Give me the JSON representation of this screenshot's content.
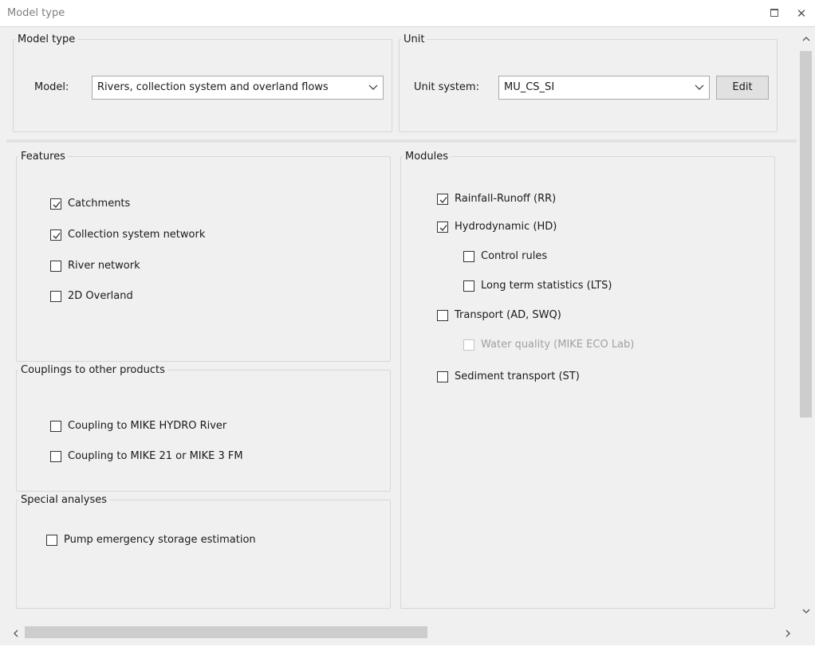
{
  "window": {
    "title": "Model type"
  },
  "model_type": {
    "legend": "Model type",
    "model_label": "Model:",
    "model_value": "Rivers, collection system and overland flows"
  },
  "unit": {
    "legend": "Unit",
    "unit_system_label": "Unit system:",
    "unit_system_value": "MU_CS_SI",
    "edit_label": "Edit"
  },
  "features": {
    "legend": "Features",
    "items": [
      {
        "label": "Catchments",
        "checked": true
      },
      {
        "label": "Collection system network",
        "checked": true
      },
      {
        "label": "River network",
        "checked": false
      },
      {
        "label": "2D Overland",
        "checked": false
      }
    ]
  },
  "couplings": {
    "legend": "Couplings to other products",
    "items": [
      {
        "label": "Coupling to MIKE HYDRO River",
        "checked": false
      },
      {
        "label": "Coupling to MIKE 21 or MIKE 3 FM",
        "checked": false
      }
    ]
  },
  "special": {
    "legend": "Special analyses",
    "items": [
      {
        "label": "Pump emergency storage estimation",
        "checked": false
      }
    ]
  },
  "modules": {
    "legend": "Modules",
    "items": [
      {
        "label": "Rainfall-Runoff (RR)",
        "checked": true,
        "enabled": true
      },
      {
        "label": "Hydrodynamic (HD)",
        "checked": true,
        "enabled": true
      },
      {
        "label": "Control rules",
        "checked": false,
        "enabled": true
      },
      {
        "label": "Long term statistics (LTS)",
        "checked": false,
        "enabled": true
      },
      {
        "label": "Transport (AD, SWQ)",
        "checked": false,
        "enabled": true
      },
      {
        "label": "Water quality (MIKE ECO Lab)",
        "checked": false,
        "enabled": false
      },
      {
        "label": "Sediment transport (ST)",
        "checked": false,
        "enabled": true
      }
    ]
  }
}
